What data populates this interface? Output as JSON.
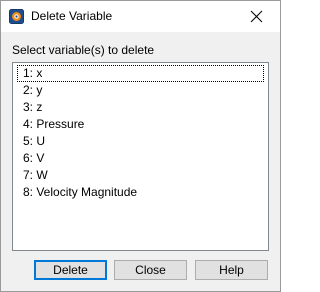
{
  "window": {
    "title": "Delete Variable",
    "close_icon": "close-x-icon",
    "app_icon": "tecplot-icon"
  },
  "prompt": "Select variable(s) to delete",
  "variables": [
    "1: x",
    "2: y",
    "3: z",
    "4: Pressure",
    "5: U",
    "6: V",
    "7: W",
    "8: Velocity Magnitude"
  ],
  "focused_index": 0,
  "buttons": {
    "delete": "Delete",
    "close": "Close",
    "help": "Help"
  },
  "colors": {
    "accent": "#0078d7",
    "dialog_bg": "#f0f0f0",
    "list_border": "#828790"
  }
}
